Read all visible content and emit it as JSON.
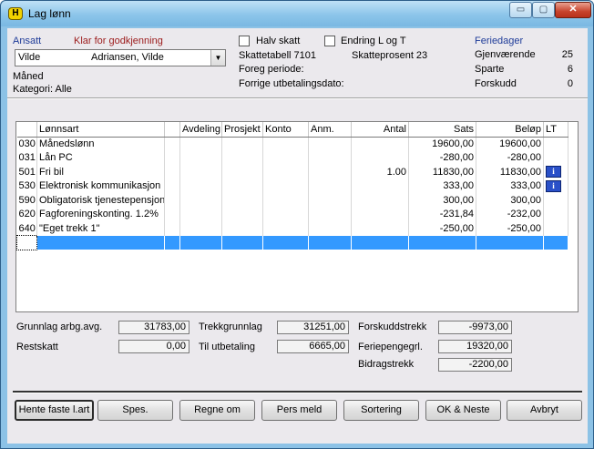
{
  "window": {
    "title": "Lag lønn",
    "app_icon": "H",
    "buttons": {
      "minimize": "▭",
      "maximize": "▢",
      "close": "✕"
    }
  },
  "header": {
    "ansatt_label": "Ansatt",
    "status": "Klar for godkjenning",
    "employee_id": "Vilde",
    "employee_name": "Adriansen, Vilde",
    "period_type": "Måned",
    "category": "Kategori: Alle",
    "halv_skatt_label": "Halv skatt",
    "halv_skatt_checked": false,
    "endring_label": "Endring L og T",
    "endring_checked": false,
    "skattetabell": "Skattetabell 7101",
    "skatteprosent": "Skatteprosent 23",
    "foreg_periode": "Foreg periode:",
    "forrige_dato": "Forrige utbetalingsdato:",
    "feriedager": {
      "title": "Feriedager",
      "rows": [
        {
          "label": "Gjenværende",
          "value": "25"
        },
        {
          "label": "Sparte",
          "value": "6"
        },
        {
          "label": "Forskudd",
          "value": "0"
        }
      ]
    }
  },
  "grid": {
    "columns": [
      "",
      "Lønnsart",
      "",
      "Avdeling",
      "Prosjekt",
      "Konto",
      "Anm.",
      "Antal",
      "Sats",
      "Beløp",
      "LT"
    ],
    "rows": [
      {
        "code": "030",
        "name": "Månedslønn",
        "antal": "",
        "sats": "19600,00",
        "belop": "19600,00",
        "info": false
      },
      {
        "code": "031",
        "name": "Lån PC",
        "antal": "",
        "sats": "-280,00",
        "belop": "-280,00",
        "info": false
      },
      {
        "code": "501",
        "name": "Fri bil",
        "antal": "1.00",
        "sats": "11830,00",
        "belop": "11830,00",
        "info": true
      },
      {
        "code": "530",
        "name": "Elektronisk kommunikasjon",
        "antal": "",
        "sats": "333,00",
        "belop": "333,00",
        "info": true
      },
      {
        "code": "590",
        "name": "Obligatorisk tjenestepensjon",
        "antal": "",
        "sats": "300,00",
        "belop": "300,00",
        "info": false
      },
      {
        "code": "620",
        "name": "Fagforeningskonting. 1.2%",
        "antal": "",
        "sats": "-231,84",
        "belop": "-232,00",
        "info": false
      },
      {
        "code": "640",
        "name": "\"Eget trekk 1\"",
        "antal": "",
        "sats": "-250,00",
        "belop": "-250,00",
        "info": false
      }
    ],
    "info_icon": "i"
  },
  "totals": {
    "grunnlag_label": "Grunnlag arbg.avg.",
    "grunnlag_value": "31783,00",
    "restskatt_label": "Restskatt",
    "restskatt_value": "0,00",
    "trekkgrunnlag_label": "Trekkgrunnlag",
    "trekkgrunnlag_value": "31251,00",
    "til_utbetaling_label": "Til utbetaling",
    "til_utbetaling_value": "6665,00",
    "forskuddstrekk_label": "Forskuddstrekk",
    "forskuddstrekk_value": "-9973,00",
    "feriepengegrl_label": "Feriepengegrl.",
    "feriepengegrl_value": "19320,00",
    "bidragstrekk_label": "Bidragstrekk",
    "bidragstrekk_value": "-2200,00"
  },
  "buttons": {
    "hente": "Hente faste l.art",
    "spes": "Spes.",
    "regne": "Regne om",
    "pers": "Pers meld",
    "sortering": "Sortering",
    "ok": "OK & Neste",
    "avbryt": "Avbryt"
  }
}
